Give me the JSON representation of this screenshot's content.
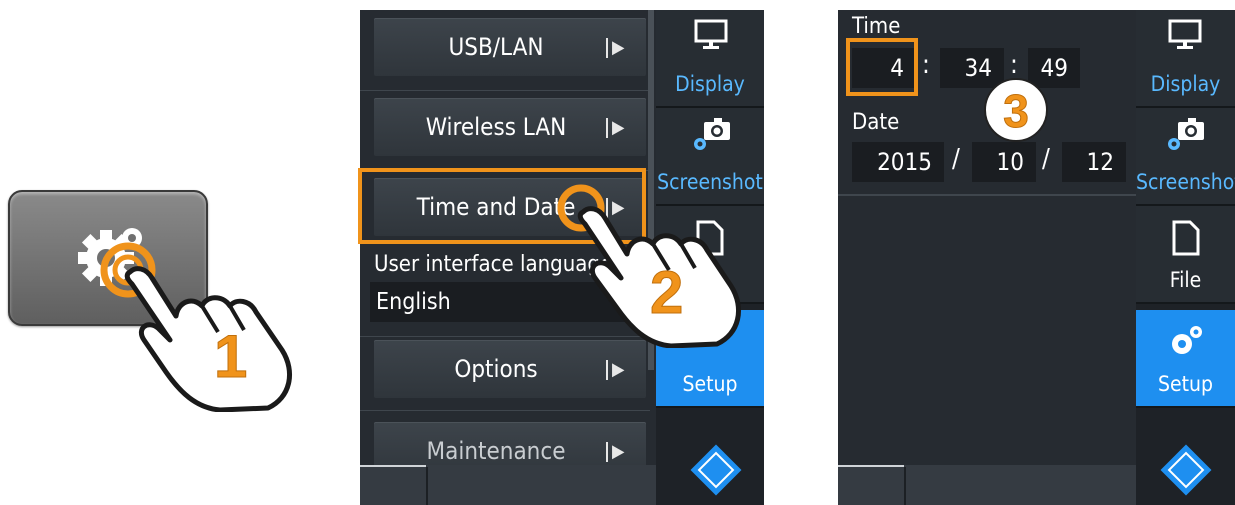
{
  "steps": {
    "one": "1",
    "two": "2",
    "three": "3"
  },
  "menu": {
    "usb_lan": "USB/LAN",
    "wireless_lan": "Wireless LAN",
    "time_and_date": "Time and Date",
    "ui_language_label": "User interface language",
    "ui_language_value": "English",
    "options": "Options",
    "maintenance": "Maintenance"
  },
  "sidebar": {
    "display": "Display",
    "screenshot": "Screenshot",
    "file": "File",
    "setup": "Setup"
  },
  "time_date": {
    "time_label": "Time",
    "hours": "4",
    "minutes": "34",
    "seconds": "49",
    "time_separator": ":",
    "date_label": "Date",
    "year": "2015",
    "month": "10",
    "day": "12",
    "date_separator": "/"
  },
  "colors": {
    "accent": "#f0931b",
    "active_tab": "#1e8ff0",
    "sidebar_text": "#59b9ff",
    "panel_bg": "#262b31"
  }
}
